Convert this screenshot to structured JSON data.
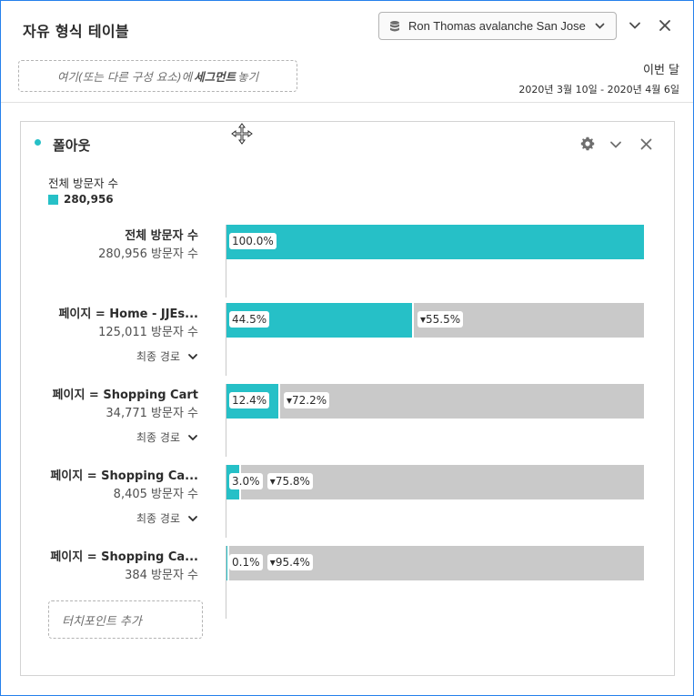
{
  "header": {
    "title": "자유 형식 테이블",
    "suite_label": "Ron Thomas avalanche San Jose"
  },
  "segment": {
    "placeholder_pre": "여기(또는 다른 구성 요소)에",
    "placeholder_bold": "세그먼트",
    "placeholder_post": "놓기"
  },
  "date_range": {
    "label": "이번 달",
    "value": "2020년 3월 10일 - 2020년 4월 6일"
  },
  "panel": {
    "title": "폴아웃",
    "metric_label": "전체 방문자 수",
    "metric_total": "280,956"
  },
  "steps": [
    {
      "name": "전체 방문자 수",
      "count": "280,956 방문자 수",
      "path_label": "",
      "pct_label": "100.0%",
      "drop_label": "",
      "fill": 1.0
    },
    {
      "name": "페이지 = Home - JJEs...",
      "count": "125,011 방문자 수",
      "path_label": "최종 경로",
      "pct_label": "44.5%",
      "drop_label": "▾55.5%",
      "fill": 0.445
    },
    {
      "name": "페이지 = Shopping Cart",
      "count": "34,771 방문자 수",
      "path_label": "최종 경로",
      "pct_label": "12.4%",
      "drop_label": "▾72.2%",
      "fill": 0.124
    },
    {
      "name": "페이지 = Shopping Ca...",
      "count": "8,405 방문자 수",
      "path_label": "최종 경로",
      "pct_label": "3.0%",
      "drop_label": "▾75.8%",
      "fill": 0.03
    },
    {
      "name": "페이지 = Shopping Ca...",
      "count": "384 방문자 수",
      "path_label": "",
      "pct_label": "0.1%",
      "drop_label": "▾95.4%",
      "fill": 0.001
    }
  ],
  "add_touchpoint": "터치포인트 추가",
  "colors": {
    "accent": "#26c0c7",
    "bar_bg": "#c9c9c9",
    "border": "#2680eb"
  }
}
